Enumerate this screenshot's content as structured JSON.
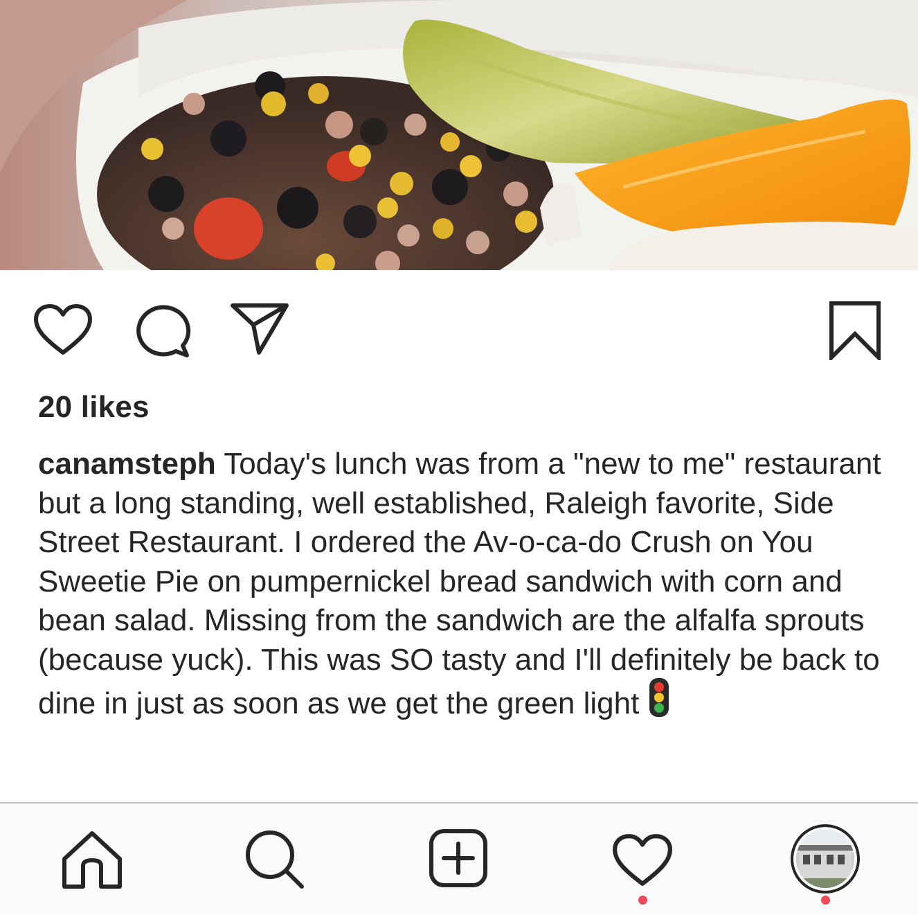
{
  "post": {
    "image_alt": "Corn and bean salad with a pickle spear and an orange wedge in a takeout container",
    "likes_text": "20 likes",
    "caption": {
      "username": "canamsteph",
      "text": "Today's lunch was from a \"new to me\" restaurant but a long standing, well established, Raleigh favorite, Side Street Restaurant. I ordered the Av-o-ca-do Crush on You Sweetie Pie on pumpernickel bread sandwich with corn and bean salad. Missing from the sandwich are the alfalfa sprouts (because yuck). This was SO tasty and I'll definitely be back to dine in just as soon as we get the green light"
    }
  },
  "action_bar": {
    "icons": [
      "heart-outline-icon",
      "comment-bubble-icon",
      "paper-plane-icon",
      "bookmark-icon"
    ]
  },
  "tab_bar": {
    "tabs": [
      "home-icon",
      "search-icon",
      "new-post-icon",
      "activity-heart-icon",
      "profile-avatar"
    ],
    "notification_dot_color": "#ed4956"
  },
  "colors": {
    "text": "#262626",
    "tab_bar_bg": "#fafafa",
    "badge": "#ed4956"
  }
}
